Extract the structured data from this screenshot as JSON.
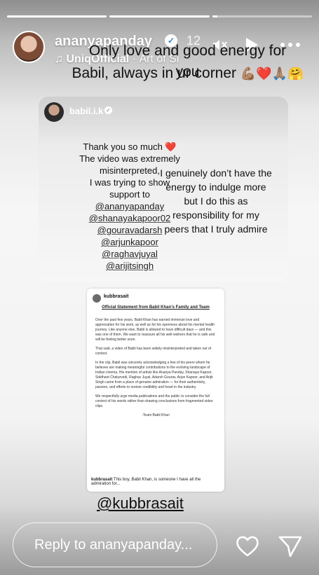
{
  "progress": [
    1,
    1,
    0.05
  ],
  "header": {
    "username": "ananyapanday",
    "time": "12",
    "music": "UniqOfficial",
    "music_sep": "·",
    "music_track": "Art of Si"
  },
  "caption": {
    "line1": "Only love and good energy for you",
    "line2": "Babil, always in ur corner",
    "emoji": "💪🏽❤️🙏🏽🤗"
  },
  "card": {
    "username": "babil.i.k",
    "left_text": [
      "Thank you so much ❤️",
      "The  video was extremely",
      "misinterpreted,",
      "I was trying to show",
      "support to"
    ],
    "mentions": [
      "@ananyapanday",
      "@shanayakapoor02",
      "@gouravadarsh",
      "@arjunkapoor",
      "@raghavjuyal",
      "@arijitsingh"
    ],
    "right_text": [
      "I genuinely don’t have the",
      "energy to indulge more",
      "but I do this as",
      "responsibility for my",
      "peers that I truly admire"
    ]
  },
  "statement": {
    "username": "kubbrasait",
    "title": "Official Statement from Babil Khan’s Family and Team",
    "paragraphs": [
      "Over the past few years, Babil Khan has earned immense love and appreciation for his work, as well as for his openness about his mental health journey. Like anyone else, Babil is allowed to have difficult days — and this was one of them. We want to reassure all his well-wishers that he is safe and will be feeling better soon.",
      "That said, a video of Babil has been widely misinterpreted and taken out of context.",
      "In the clip, Babil was sincerely acknowledging a few of his peers whom he believes are making meaningful contributions to the evolving landscape of Indian cinema. His mention of artists like Ananya Panday, Shanaya Kapoor, Siddhant Chaturvedi, Raghav Juyal, Adarsh Gourav, Arjun Kapoor, and Arijit Singh came from a place of genuine admiration — for their authenticity, passion, and efforts to restore credibility and heart in the industry.",
      "We respectfully urge media publications and the public to consider the full context of his words rather than drawing conclusions from fragmented video clips."
    ],
    "sign": "-Team Babil Khan",
    "footer_user": "kubbrasait",
    "footer_text": "This boy, Babil Khan,  is someone I have all the admiration for..."
  },
  "tag": "@kubbrasait",
  "reply": {
    "placeholder": "Reply to ananyapanday..."
  },
  "icons": {
    "mute": "speaker-muted-icon",
    "play": "play-icon",
    "more": "more-icon",
    "like": "heart-icon",
    "share": "send-icon"
  }
}
